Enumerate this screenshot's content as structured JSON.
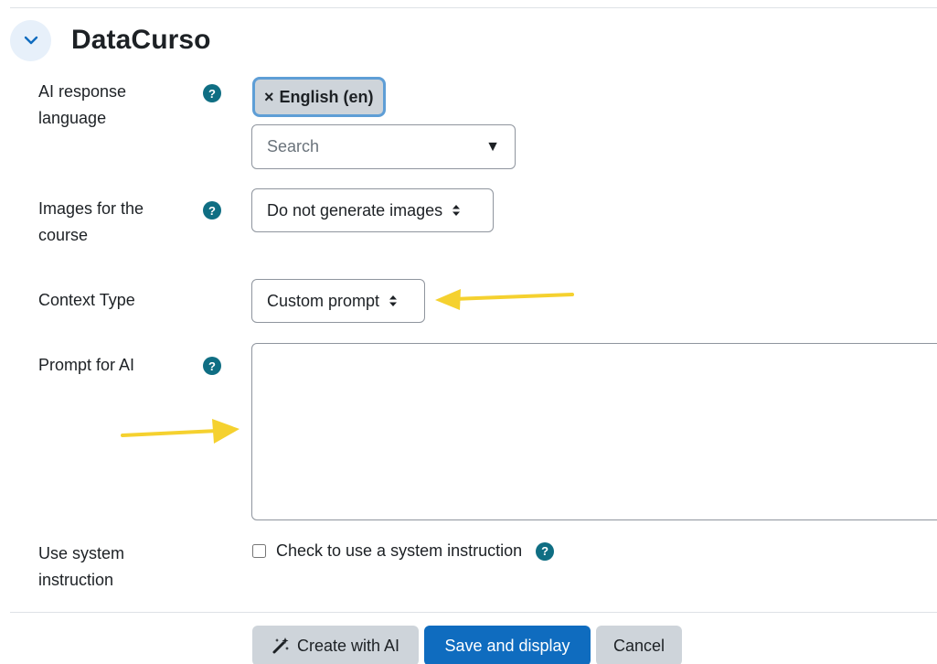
{
  "section": {
    "title": "DataCurso"
  },
  "language": {
    "label": "AI response language",
    "selected_chip": "English (en)",
    "chip_remove": "×",
    "search_placeholder": "Search"
  },
  "images": {
    "label": "Images for the course",
    "value": "Do not generate images"
  },
  "context_type": {
    "label": "Context Type",
    "value": "Custom prompt"
  },
  "prompt": {
    "label": "Prompt for AI",
    "value": ""
  },
  "system_instruction": {
    "label": "Use system instruction",
    "checkbox_label": "Check to use a system instruction",
    "checked": false
  },
  "help_glyph": "?",
  "actions": {
    "create_ai": "Create with AI",
    "save_display": "Save and display",
    "cancel": "Cancel"
  },
  "colors": {
    "primary": "#0f6cbf",
    "help_icon": "#0f6e83",
    "annotation_arrow": "#f5d12f",
    "secondary_button": "#ced4da"
  },
  "icons": {
    "section_toggle": "chevron-down-icon",
    "help": "question-circle-icon",
    "create_ai": "magic-wand-icon",
    "dropdown": "caret-down-icon",
    "select": "sort-arrows-icon"
  }
}
